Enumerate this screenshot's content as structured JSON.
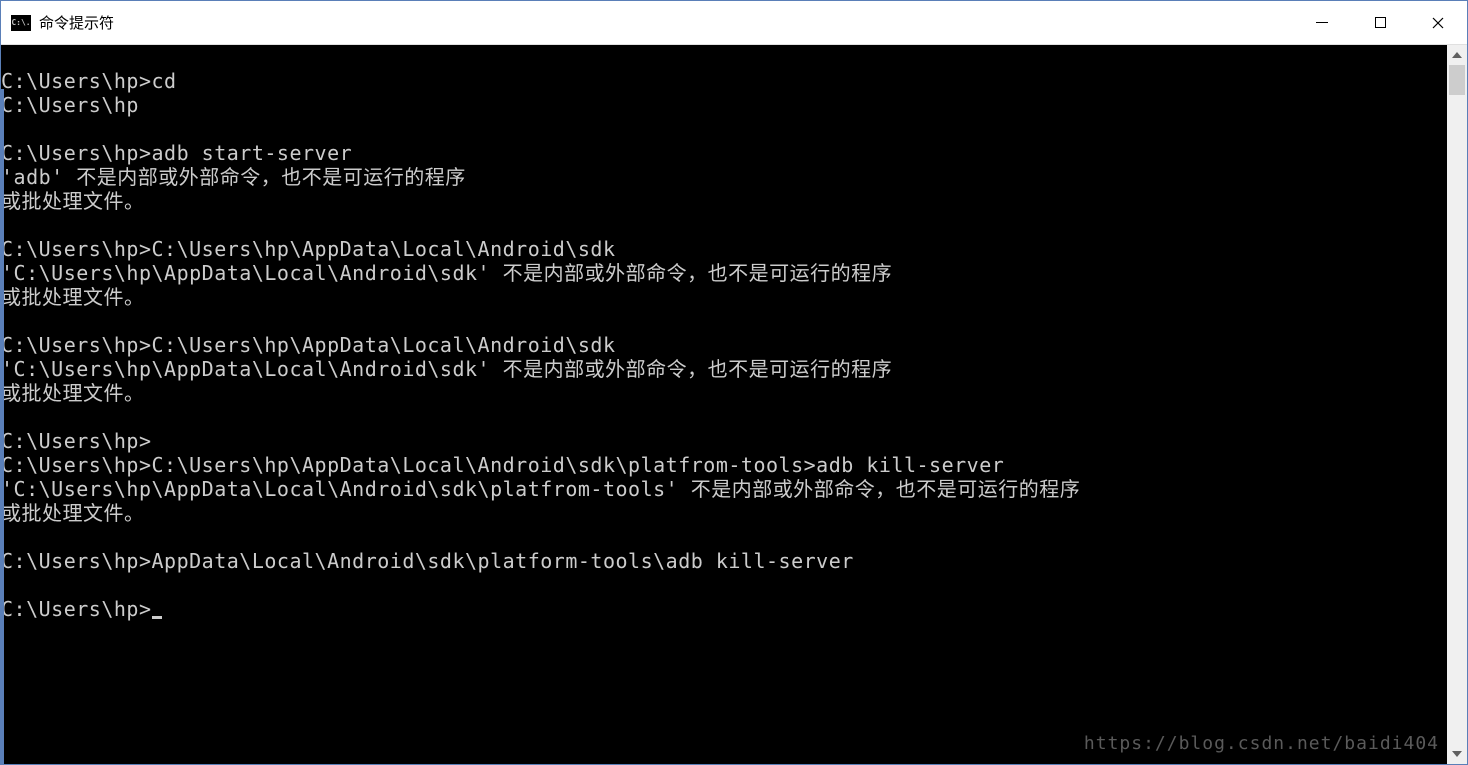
{
  "window": {
    "title": "命令提示符",
    "icon_text": "C:\\."
  },
  "terminal": {
    "lines": [
      "",
      "C:\\Users\\hp>cd",
      "C:\\Users\\hp",
      "",
      "C:\\Users\\hp>adb start-server",
      "'adb' 不是内部或外部命令，也不是可运行的程序",
      "或批处理文件。",
      "",
      "C:\\Users\\hp>C:\\Users\\hp\\AppData\\Local\\Android\\sdk",
      "'C:\\Users\\hp\\AppData\\Local\\Android\\sdk' 不是内部或外部命令，也不是可运行的程序",
      "或批处理文件。",
      "",
      "C:\\Users\\hp>C:\\Users\\hp\\AppData\\Local\\Android\\sdk",
      "'C:\\Users\\hp\\AppData\\Local\\Android\\sdk' 不是内部或外部命令，也不是可运行的程序",
      "或批处理文件。",
      "",
      "C:\\Users\\hp>",
      "C:\\Users\\hp>C:\\Users\\hp\\AppData\\Local\\Android\\sdk\\platfrom-tools>adb kill-server",
      "'C:\\Users\\hp\\AppData\\Local\\Android\\sdk\\platfrom-tools' 不是内部或外部命令，也不是可运行的程序",
      "或批处理文件。",
      "",
      "C:\\Users\\hp>AppData\\Local\\Android\\sdk\\platform-tools\\adb kill-server",
      "",
      "C:\\Users\\hp>"
    ],
    "current_prompt": "C:\\Users\\hp>"
  },
  "watermark": "https://blog.csdn.net/baidi404"
}
